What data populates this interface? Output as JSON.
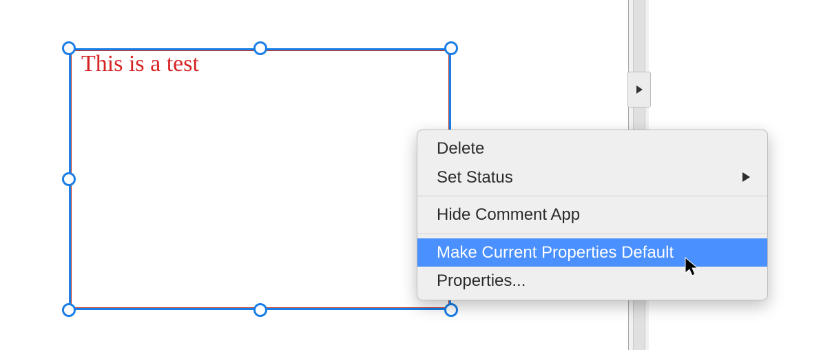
{
  "text_box": {
    "content": "This is a test"
  },
  "menu": {
    "delete": "Delete",
    "set_status": "Set Status",
    "hide_comment_app": "Hide Comment App",
    "make_default": "Make Current Properties Default",
    "properties": "Properties..."
  }
}
